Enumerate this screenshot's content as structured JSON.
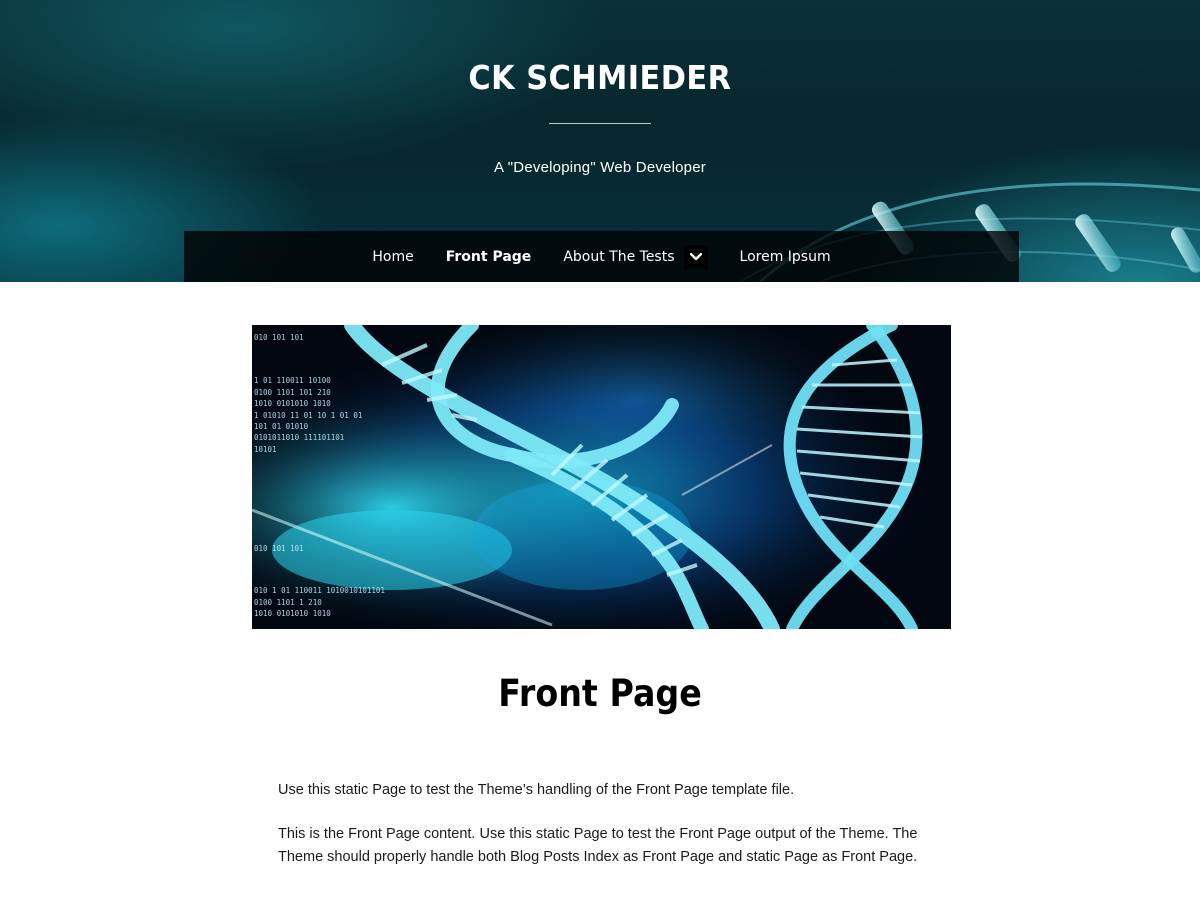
{
  "header": {
    "site_title": "CK SCHMIEDER",
    "tagline": "A \"Developing\" Web Developer"
  },
  "nav": {
    "items": [
      {
        "label": "Home",
        "current": false
      },
      {
        "label": "Front Page",
        "current": true
      },
      {
        "label": "About The Tests",
        "current": false,
        "has_submenu": true,
        "submenu_icon": "chevron-down-icon"
      },
      {
        "label": "Lorem Ipsum",
        "current": false
      }
    ]
  },
  "featured_image": {
    "description_icon": "dna-helix-image",
    "binary_rows_top": [
      "010 101 101",
      "1 01  110011  10100",
      "0100  1101 101 210",
      "1010  0101010 1010",
      "1 01010 11 01 10  1 01 01",
      "101 01 01010",
      "0101011010 111101101",
      "10101"
    ],
    "binary_rows_bottom": [
      "010 101 101",
      "010   1 01  110011  1010010101101",
      "0100   1101 1 210",
      "1010   0101010 1010"
    ]
  },
  "page": {
    "title": "Front Page",
    "paragraphs": [
      "Use this static Page to test the Theme’s handling of the Front Page template file.",
      "This is the Front Page content. Use this static Page to test the Front Page output of the Theme. The Theme should properly handle both Blog Posts Index as Front Page and static Page as Front Page."
    ]
  },
  "colors": {
    "header_bg": "#08262d",
    "nav_bg": "#000000",
    "accent_cyan": "#3fd6ec",
    "text": "#1a1a1a"
  }
}
